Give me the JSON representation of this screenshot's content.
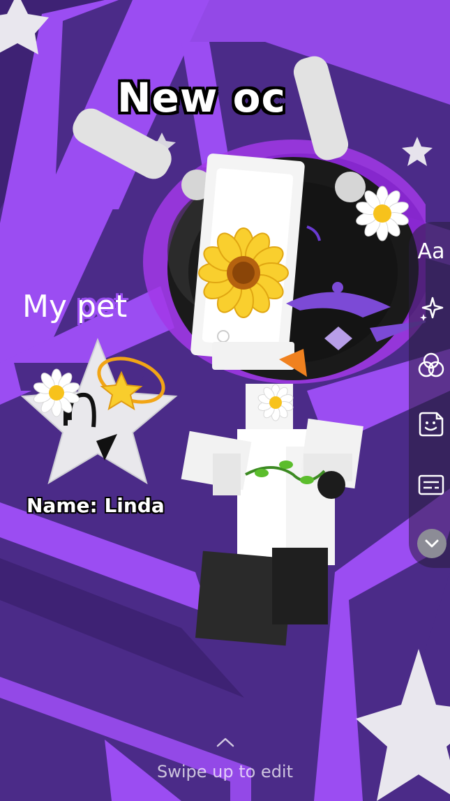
{
  "story": {
    "title_text": "New oc",
    "pet_label": "My pet",
    "pet_name": "Name: Linda"
  },
  "toolbar": {
    "text_tool_label": "Aa",
    "items": [
      {
        "name": "text-tool",
        "icon": "text-aa-icon"
      },
      {
        "name": "effects-tool",
        "icon": "sparkle-icon"
      },
      {
        "name": "filters-tool",
        "icon": "overlapping-circles-icon"
      },
      {
        "name": "sticker-tool",
        "icon": "sticker-smile-icon"
      },
      {
        "name": "caption-tool",
        "icon": "caption-box-icon"
      },
      {
        "name": "more-tools",
        "icon": "chevron-down-icon"
      }
    ]
  },
  "footer": {
    "swipe_hint": "Swipe up to edit"
  },
  "colors": {
    "background": "#4b2b88",
    "stripe": "#9b4df2",
    "toolbar_bg": "rgba(40,30,60,0.55)"
  }
}
